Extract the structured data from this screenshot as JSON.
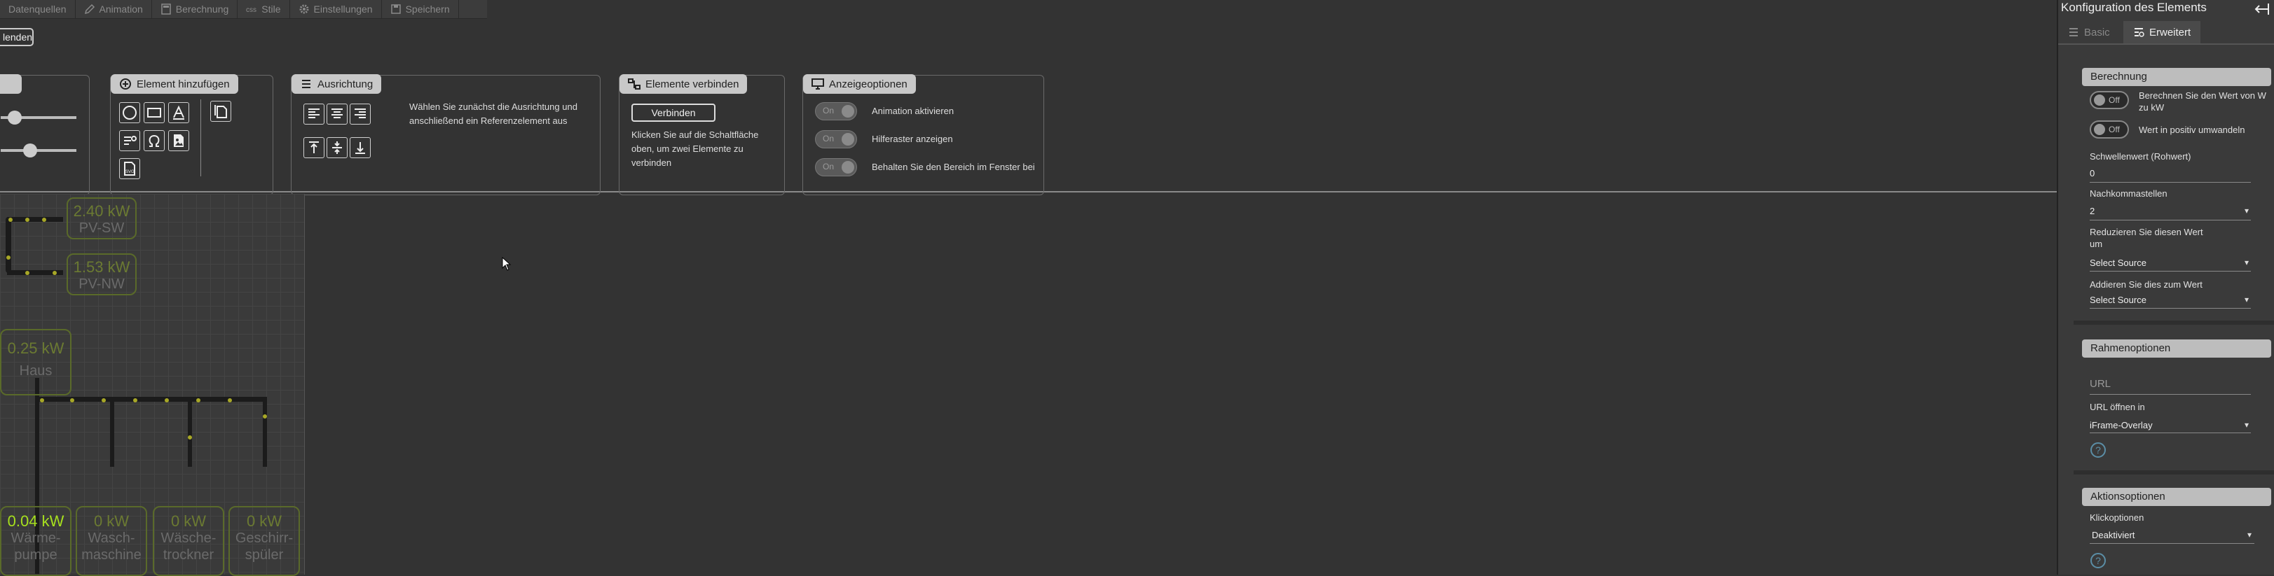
{
  "tabs": [
    {
      "label": "Datenquellen",
      "icon": "database-icon"
    },
    {
      "label": "Animation",
      "icon": "pencil-icon"
    },
    {
      "label": "Berechnung",
      "icon": "calculator-icon"
    },
    {
      "label": "Stile",
      "icon": "css-icon"
    },
    {
      "label": "Einstellungen",
      "icon": "gear-icon"
    },
    {
      "label": "Speichern",
      "icon": "save-icon"
    }
  ],
  "toolbar": {
    "partial_button": "lenden",
    "add_element": {
      "title": "Element hinzufügen"
    },
    "alignment": {
      "title": "Ausrichtung",
      "hint": "Wählen Sie zunächst die Ausrichtung und anschließend ein Referenzelement aus"
    },
    "connect": {
      "title": "Elemente verbinden",
      "button": "Verbinden",
      "hint": "Klicken Sie auf die Schaltfläche oben, um zwei Elemente zu verbinden"
    },
    "display": {
      "title": "Anzeigeoptionen",
      "options": [
        {
          "toggle": "On",
          "label": "Animation aktivieren"
        },
        {
          "toggle": "On",
          "label": "Hilferaster anzeigen"
        },
        {
          "toggle": "On",
          "label": "Behalten Sie den Bereich im Fenster bei"
        }
      ]
    }
  },
  "canvas": {
    "tiles": [
      {
        "value": "2.40 kW",
        "name": "PV-SW"
      },
      {
        "value": "1.53 kW",
        "name": "PV-NW"
      },
      {
        "value": "0.25 kW",
        "name": "Haus"
      },
      {
        "value": "0.04 kW",
        "name": "Wärme-\npumpe"
      },
      {
        "value": "0 kW",
        "name": "Wasch-\nmaschine"
      },
      {
        "value": "0 kW",
        "name": "Wäsche-\ntrockner"
      },
      {
        "value": "0 kW",
        "name": "Geschirr-\nspüler"
      }
    ]
  },
  "panel": {
    "title": "Konfiguration des Elements",
    "tabs": [
      {
        "label": "Basic",
        "icon": "list-icon"
      },
      {
        "label": "Erweitert",
        "icon": "settings-list-icon"
      }
    ],
    "calculation": {
      "title": "Berechnung",
      "toggle1": {
        "state": "Off",
        "label": "Berechnen Sie den Wert von W zu kW"
      },
      "toggle2": {
        "state": "Off",
        "label": "Wert in positiv umwandeln"
      },
      "threshold_label": "Schwellenwert (Rohwert)",
      "threshold_value": "0",
      "decimals_label": "Nachkommastellen",
      "decimals_value": "2",
      "reduce_label": "Reduzieren Sie diesen Wert um",
      "reduce_value": "Select Source",
      "add_label": "Addieren Sie dies zum Wert",
      "add_value": "Select Source"
    },
    "frame": {
      "title": "Rahmenoptionen",
      "url_placeholder": "URL",
      "open_label": "URL öffnen in",
      "open_value": "iFrame-Overlay"
    },
    "actions": {
      "title": "Aktionsoptionen",
      "click_label": "Klickoptionen",
      "click_value": "Deaktiviert"
    }
  },
  "colors": {
    "background": "#333333",
    "panel": "#3a3a3a",
    "accent_green": "#a7e01e",
    "tile_green": "#5a6a2a"
  }
}
